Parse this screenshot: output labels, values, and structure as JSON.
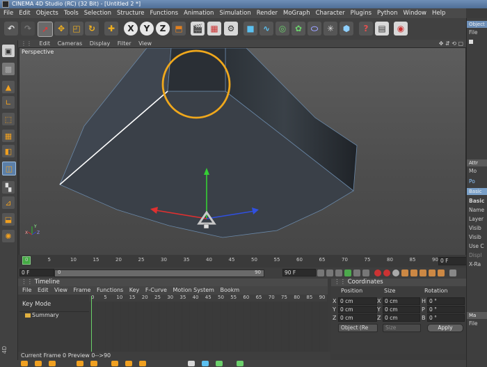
{
  "window": {
    "title": "CINEMA 4D Studio (RC) (32 Bit) - [Untitled 2 *]"
  },
  "menu": [
    "File",
    "Edit",
    "Objects",
    "Tools",
    "Selection",
    "Structure",
    "Functions",
    "Animation",
    "Simulation",
    "Render",
    "MoGraph",
    "Character",
    "Plugins",
    "Python",
    "Window",
    "Help"
  ],
  "viewport": {
    "menu": [
      "Edit",
      "Cameras",
      "Display",
      "Filter",
      "View"
    ],
    "label": "Perspective",
    "axis_labels": {
      "x": "X",
      "y": "Y",
      "z": "Z"
    },
    "highlight_color": "#f0a81c"
  },
  "time_ruler": {
    "ticks": [
      "0",
      "5",
      "10",
      "15",
      "20",
      "25",
      "30",
      "35",
      "40",
      "45",
      "50",
      "55",
      "60",
      "65",
      "70",
      "75",
      "80",
      "85",
      "90"
    ],
    "frame_value": "0 F"
  },
  "playback": {
    "start_field": "0 F",
    "end_field": "90 F",
    "start_small": "0",
    "end_small": "90"
  },
  "timeline": {
    "title": "Timeline",
    "menu": [
      "File",
      "Edit",
      "View",
      "Frame",
      "Functions",
      "Key",
      "F-Curve",
      "Motion System",
      "Bookm"
    ],
    "key_mode": "Key Mode",
    "summary": "Summary",
    "ticks": [
      "0",
      "5",
      "10",
      "15",
      "20",
      "25",
      "30",
      "35",
      "40",
      "45",
      "50",
      "55",
      "60",
      "65",
      "70",
      "75",
      "80",
      "85",
      "90"
    ],
    "status": "Current Frame  0  Preview  0-->90"
  },
  "coordinates": {
    "title": "Coordinates",
    "headers": [
      "Position",
      "Size",
      "Rotation"
    ],
    "rows": [
      {
        "axis": "X",
        "pos": "0 cm",
        "size_axis": "X",
        "size": "0 cm",
        "rot_axis": "H",
        "rot": "0 °"
      },
      {
        "axis": "Y",
        "pos": "0 cm",
        "size_axis": "Y",
        "size": "0 cm",
        "rot_axis": "P",
        "rot": "0 °"
      },
      {
        "axis": "Z",
        "pos": "0 cm",
        "size_axis": "Z",
        "size": "0 cm",
        "rot_axis": "B",
        "rot": "0 °"
      }
    ],
    "mode_select": "Object (Re",
    "size_select": "Size",
    "apply": "Apply"
  },
  "right_panel": {
    "objects_tab": "Object",
    "objects_file": "File",
    "attr_tab": "Attr",
    "attr_mode": "Mo",
    "attr_po": "Po",
    "basic_tab": "Basic",
    "basic_title": "Basic",
    "attr_items": [
      "Name",
      "Layer",
      "Visib",
      "Visib",
      "Use C",
      "Displ",
      "X-Ra"
    ],
    "material_tab": "Ma",
    "material_file": "File"
  },
  "side_label": "4D"
}
